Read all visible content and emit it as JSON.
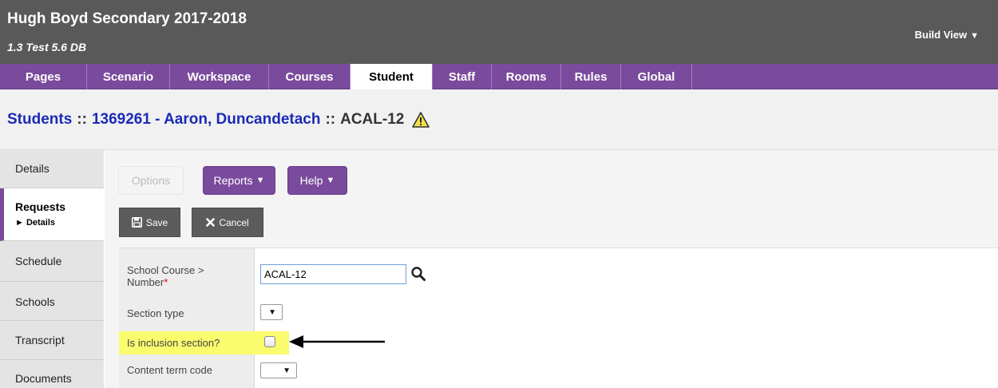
{
  "header": {
    "title": "Hugh Boyd Secondary 2017-2018",
    "subtitle": "1.3 Test 5.6 DB",
    "build_view": "Build View"
  },
  "topnav": {
    "tabs": [
      {
        "label": "Pages"
      },
      {
        "label": "Scenario"
      },
      {
        "label": "Workspace"
      },
      {
        "label": "Courses"
      },
      {
        "label": "Student",
        "active": true
      },
      {
        "label": "Staff"
      },
      {
        "label": "Rooms"
      },
      {
        "label": "Rules"
      },
      {
        "label": "Global"
      }
    ]
  },
  "breadcrumb": {
    "students": "Students",
    "sep": "::",
    "student": "1369261 - Aaron, Duncandetach",
    "course": "ACAL-12"
  },
  "sidenav": {
    "items": [
      {
        "label": "Details"
      },
      {
        "label": "Requests",
        "sub": "► Details",
        "active": true
      },
      {
        "label": "Schedule"
      },
      {
        "label": "Schools"
      },
      {
        "label": "Transcript"
      },
      {
        "label": "Documents"
      }
    ]
  },
  "toolbar": {
    "options": "Options",
    "reports": "Reports",
    "help": "Help",
    "save": "Save",
    "cancel": "Cancel"
  },
  "form": {
    "school_course_label_1": "School Course >",
    "school_course_label_2": "Number",
    "required_mark": "*",
    "school_course_value": "ACAL-12",
    "section_type_label": "Section type",
    "inclusion_label": "Is inclusion section?",
    "content_term_label": "Content term code"
  },
  "colors": {
    "nav_purple": "#7a4a9c",
    "header_gray": "#595959",
    "link_blue": "#1a2bb5",
    "highlight_yellow": "#fbfb6e"
  }
}
